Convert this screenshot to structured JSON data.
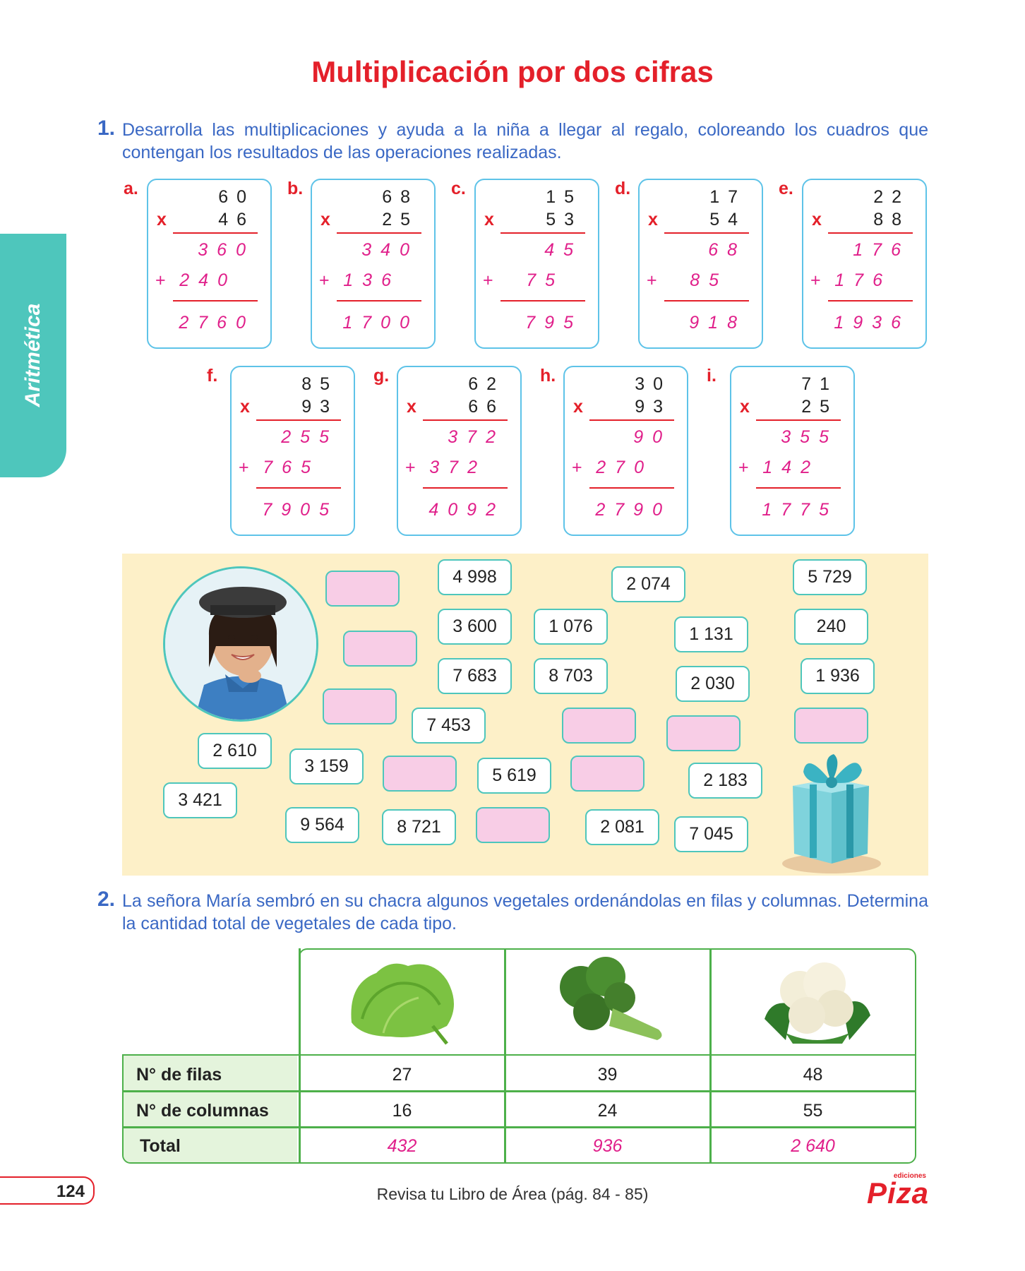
{
  "title": "Multiplicación por dos cifras",
  "side_tab": "Aritmética",
  "q1": {
    "number": "1.",
    "text": "Desarrolla las multiplicaciones y ayuda a la niña a llegar al regalo, coloreando los cuadros que contengan los resultados de las operaciones realizadas."
  },
  "ops": [
    {
      "label": "a.",
      "a": "60",
      "b": "46",
      "p1": "360",
      "p2": "240",
      "r": "2760"
    },
    {
      "label": "b.",
      "a": "68",
      "b": "25",
      "p1": "340",
      "p2": "136",
      "r": "1700"
    },
    {
      "label": "c.",
      "a": "15",
      "b": "53",
      "p1": "45",
      "p2": "75",
      "r": "795"
    },
    {
      "label": "d.",
      "a": "17",
      "b": "54",
      "p1": "68",
      "p2": "85",
      "r": "918"
    },
    {
      "label": "e.",
      "a": "22",
      "b": "88",
      "p1": "176",
      "p2": "176",
      "r": "1936"
    },
    {
      "label": "f.",
      "a": "85",
      "b": "93",
      "p1": "255",
      "p2": "765",
      "r": "7905"
    },
    {
      "label": "g.",
      "a": "62",
      "b": "66",
      "p1": "372",
      "p2": "372",
      "r": "4092"
    },
    {
      "label": "h.",
      "a": "30",
      "b": "93",
      "p1": "90",
      "p2": "270",
      "r": "2790"
    },
    {
      "label": "i.",
      "a": "71",
      "b": "25",
      "p1": "355",
      "p2": "142",
      "r": "1775"
    }
  ],
  "op_symbols": {
    "times": "x",
    "plus": "+"
  },
  "maze_cells": [
    "",
    "4 998",
    "2 074",
    "5 729",
    "",
    "3 600",
    "1 076",
    "1 131",
    "240",
    "7 683",
    "8 703",
    "2 030",
    "1 936",
    "",
    "7 453",
    "",
    "",
    "",
    "2 610",
    "3 159",
    "",
    "5 619",
    "",
    "2 183",
    "3 421",
    "9 564",
    "8 721",
    "",
    "2 081",
    "7 045"
  ],
  "q2": {
    "number": "2.",
    "text": "La señora María sembró en su chacra algunos vegetales ordenándolas en filas y columnas. Determina la cantidad total de vegetales de cada tipo."
  },
  "table": {
    "rows": [
      {
        "label": "N° de filas",
        "values": [
          "27",
          "39",
          "48"
        ]
      },
      {
        "label": "N° de columnas",
        "values": [
          "16",
          "24",
          "55"
        ]
      },
      {
        "label": "Total",
        "values": [
          "432",
          "936",
          "2 640"
        ]
      }
    ]
  },
  "footer": {
    "page": "124",
    "note": "Revisa tu Libro de Área (pág. 84 - 85)",
    "brand_small": "ediciones",
    "brand": "Piza"
  },
  "colors": {
    "title": "#e4202a",
    "accent": "#4ec6bc",
    "answer": "#e01f8a",
    "question": "#3a68c4",
    "table": "#4db04a"
  }
}
